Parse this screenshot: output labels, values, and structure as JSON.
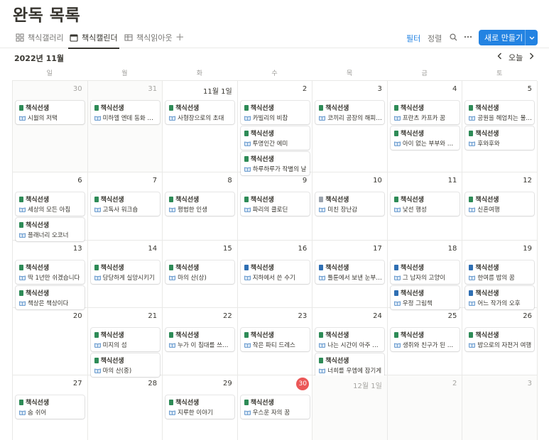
{
  "page": {
    "title": "완독 목록"
  },
  "tabs": [
    {
      "label": "책식갤러리",
      "icon": "gallery-icon",
      "active": false
    },
    {
      "label": "책식캘린더",
      "icon": "calendar-icon",
      "active": true
    },
    {
      "label": "책식읽아웃",
      "icon": "table-icon",
      "active": false
    }
  ],
  "toolbar": {
    "add_view": "+",
    "filter": "필터",
    "sort": "정렬",
    "new_button": "새로 만들기"
  },
  "calendar": {
    "month": "2022년 11월",
    "today_label": "오늘",
    "weekdays": [
      "일",
      "월",
      "화",
      "수",
      "목",
      "금",
      "토"
    ],
    "today_date": "30"
  },
  "colors": {
    "accent": "#2383e2",
    "today": "#eb5757",
    "book_green": "#2e8b57",
    "book_blue": "#2f6fb3"
  },
  "weeks": [
    {
      "days": [
        {
          "label": "30",
          "muted": true,
          "events": [
            {
              "tag": "책식선생",
              "title": "시월의 저택",
              "icon": "green"
            }
          ]
        },
        {
          "label": "31",
          "muted": true,
          "events": [
            {
              "tag": "책식선생",
              "title": "미하엘 엔데 동화 전집",
              "icon": "green"
            }
          ]
        },
        {
          "label": "11월 1일",
          "muted": false,
          "events": [
            {
              "tag": "책식선생",
              "title": "사형장으로의 초대",
              "icon": "green"
            }
          ]
        },
        {
          "label": "2",
          "muted": false,
          "events": [
            {
              "tag": "책식선생",
              "title": "카빌리의 비참",
              "icon": "green"
            },
            {
              "tag": "책식선생",
              "title": "투명인간 에미",
              "icon": "green"
            },
            {
              "tag": "책식선생",
              "title": "하루하루가 작별의 날",
              "icon": "green"
            }
          ]
        },
        {
          "label": "3",
          "muted": false,
          "events": [
            {
              "tag": "책식선생",
              "title": "코끼리 공장의 해피엔딩",
              "icon": "green"
            }
          ]
        },
        {
          "label": "4",
          "muted": false,
          "events": [
            {
              "tag": "책식선생",
              "title": "프란츠 카프카 꿈",
              "icon": "green"
            },
            {
              "tag": "책식선생",
              "title": "아이 없는 부부와 고양이",
              "icon": "green"
            }
          ]
        },
        {
          "label": "5",
          "muted": false,
          "events": [
            {
              "tag": "책식선생",
              "title": "공원을 헤엄치는 물고기",
              "icon": "green"
            },
            {
              "tag": "책식선생",
              "title": "후와후와",
              "icon": "green"
            }
          ]
        }
      ]
    },
    {
      "days": [
        {
          "label": "6",
          "muted": false,
          "events": [
            {
              "tag": "책식선생",
              "title": "세상의 모든 아침",
              "icon": "green"
            },
            {
              "tag": "책식선생",
              "title": "플래너리 오코너",
              "icon": "green"
            }
          ]
        },
        {
          "label": "7",
          "muted": false,
          "events": [
            {
              "tag": "책식선생",
              "title": "고독사 워크숍",
              "icon": "green"
            }
          ]
        },
        {
          "label": "8",
          "muted": false,
          "events": [
            {
              "tag": "책식선생",
              "title": "평범한 인생",
              "icon": "green"
            }
          ]
        },
        {
          "label": "9",
          "muted": false,
          "events": [
            {
              "tag": "책식선생",
              "title": "파리의 클로딘",
              "icon": "green"
            }
          ]
        },
        {
          "label": "10",
          "muted": false,
          "events": [
            {
              "tag": "책식선생",
              "title": "미친 장난감",
              "icon": "gray"
            }
          ]
        },
        {
          "label": "11",
          "muted": false,
          "events": [
            {
              "tag": "책식선생",
              "title": "낯선 행성",
              "icon": "green"
            }
          ]
        },
        {
          "label": "12",
          "muted": false,
          "events": [
            {
              "tag": "책식선생",
              "title": "신혼여행",
              "icon": "green"
            }
          ]
        }
      ]
    },
    {
      "days": [
        {
          "label": "13",
          "muted": false,
          "events": [
            {
              "tag": "책식선생",
              "title": "딱 1년만 쉬겠습니다",
              "icon": "green"
            },
            {
              "tag": "책식선생",
              "title": "책상은 책상이다",
              "icon": "green"
            }
          ]
        },
        {
          "label": "14",
          "muted": false,
          "events": [
            {
              "tag": "책식선생",
              "title": "당당하게 실망시키기",
              "icon": "green"
            }
          ]
        },
        {
          "label": "15",
          "muted": false,
          "events": [
            {
              "tag": "책식선생",
              "title": "마의 산(상)",
              "icon": "green"
            }
          ]
        },
        {
          "label": "16",
          "muted": false,
          "events": [
            {
              "tag": "책식선생",
              "title": "지하에서 쓴 수기",
              "icon": "blue"
            }
          ]
        },
        {
          "label": "17",
          "muted": false,
          "events": [
            {
              "tag": "책식선생",
              "title": "툴툰에서 보낸 눈부신 날",
              "icon": "blue"
            }
          ]
        },
        {
          "label": "18",
          "muted": false,
          "events": [
            {
              "tag": "책식선생",
              "title": "그 남자의 고양이",
              "icon": "blue"
            },
            {
              "tag": "책식선생",
              "title": "우정 그림책",
              "icon": "blue"
            }
          ]
        },
        {
          "label": "19",
          "muted": false,
          "events": [
            {
              "tag": "책식선생",
              "title": "한여름 밤의 꿈",
              "icon": "blue"
            },
            {
              "tag": "책식선생",
              "title": "어느 작가의 오후",
              "icon": "blue"
            }
          ]
        }
      ]
    },
    {
      "days": [
        {
          "label": "20",
          "muted": false,
          "events": []
        },
        {
          "label": "21",
          "muted": false,
          "events": [
            {
              "tag": "책식선생",
              "title": "미지의 섬",
              "icon": "green"
            },
            {
              "tag": "책식선생",
              "title": "마의 산(중)",
              "icon": "green"
            }
          ]
        },
        {
          "label": "22",
          "muted": false,
          "events": [
            {
              "tag": "책식선생",
              "title": "누가 이 침대를 쓰셨나요",
              "icon": "green"
            }
          ]
        },
        {
          "label": "23",
          "muted": false,
          "events": [
            {
              "tag": "책식선생",
              "title": "작은 파티 드레스",
              "icon": "green"
            }
          ]
        },
        {
          "label": "24",
          "muted": false,
          "events": [
            {
              "tag": "책식선생",
              "title": "나는 시간이 아주 많아요",
              "icon": "green"
            },
            {
              "tag": "책식선생",
              "title": "너희를 우엠에 잠기게",
              "icon": "green"
            }
          ]
        },
        {
          "label": "25",
          "muted": false,
          "events": [
            {
              "tag": "책식선생",
              "title": "생쥐와 친구가 된 고양이",
              "icon": "green"
            }
          ]
        },
        {
          "label": "26",
          "muted": false,
          "events": [
            {
              "tag": "책식선생",
              "title": "밤으로의 자전거 여행",
              "icon": "green"
            }
          ]
        }
      ]
    },
    {
      "days": [
        {
          "label": "27",
          "muted": false,
          "events": [
            {
              "tag": "책식선생",
              "title": "숨 쉬어",
              "icon": "green"
            }
          ]
        },
        {
          "label": "28",
          "muted": false,
          "events": []
        },
        {
          "label": "29",
          "muted": false,
          "events": [
            {
              "tag": "책식선생",
              "title": "지루한 이야기",
              "icon": "green"
            }
          ]
        },
        {
          "label": "30",
          "muted": false,
          "today": true,
          "events": [
            {
              "tag": "책식선생",
              "title": "우스운 자의 꿈",
              "icon": "green"
            }
          ]
        },
        {
          "label": "12월 1일",
          "muted": true,
          "events": []
        },
        {
          "label": "2",
          "muted": true,
          "events": []
        },
        {
          "label": "3",
          "muted": true,
          "events": []
        }
      ]
    }
  ]
}
